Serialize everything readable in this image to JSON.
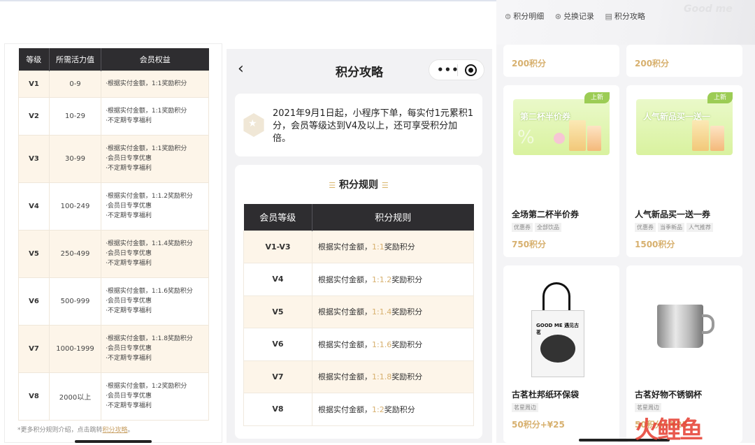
{
  "panel1": {
    "headers": [
      "等级",
      "所需活力值",
      "会员权益"
    ],
    "rows": [
      {
        "level": "V1",
        "value": "0-9",
        "benefits": [
          "·根据实付金额，1:1奖励积分"
        ]
      },
      {
        "level": "V2",
        "value": "10-29",
        "benefits": [
          "·根据实付金额，1:1奖励积分",
          "·不定期专享福利"
        ]
      },
      {
        "level": "V3",
        "value": "30-99",
        "benefits": [
          "·根据实付金额，1:1奖励积分",
          "·会员日专享优惠",
          "·不定期专享福利"
        ]
      },
      {
        "level": "V4",
        "value": "100-249",
        "benefits": [
          "·根据实付金额，1:1.2奖励积分",
          "·会员日专享优惠",
          "·不定期专享福利"
        ]
      },
      {
        "level": "V5",
        "value": "250-499",
        "benefits": [
          "·根据实付金额，1:1.4奖励积分",
          "·会员日专享优惠",
          "·不定期专享福利"
        ]
      },
      {
        "level": "V6",
        "value": "500-999",
        "benefits": [
          "·根据实付金额，1:1.6奖励积分",
          "·会员日专享优惠",
          "·不定期专享福利"
        ]
      },
      {
        "level": "V7",
        "value": "1000-1999",
        "benefits": [
          "·根据实付金额，1:1.8奖励积分",
          "·会员日专享优惠",
          "·不定期专享福利"
        ]
      },
      {
        "level": "V8",
        "value": "2000以上",
        "benefits": [
          "·根据实付金额，1:2奖励积分",
          "·会员日专享优惠",
          "·不定期专享福利"
        ]
      }
    ],
    "footnote": "*更多积分规则介绍，点击跳转",
    "footnote_link": "积分攻略",
    "footnote_end": "。"
  },
  "panel2": {
    "back_icon": "‹",
    "title": "积分攻略",
    "menu_icon": "•••",
    "notice": "2021年9月1日起，小程序下单，每实付1元累积1分，会员等级达到V4及以上，还可享受积分加倍。",
    "rules_title": "积分规则",
    "deco": "☰",
    "headers": [
      "会员等级",
      "积分规则"
    ],
    "rows": [
      {
        "level": "V1-V3",
        "pre": "根据实付金额，",
        "ratio": "1:1",
        "post": "奖励积分"
      },
      {
        "level": "V4",
        "pre": "根据实付金额，",
        "ratio": "1:1.2",
        "post": "奖励积分"
      },
      {
        "level": "V5",
        "pre": "根据实付金额，",
        "ratio": "1:1.4",
        "post": "奖励积分"
      },
      {
        "level": "V6",
        "pre": "根据实付金额，",
        "ratio": "1:1.6",
        "post": "奖励积分"
      },
      {
        "level": "V7",
        "pre": "根据实付金额，",
        "ratio": "1:1.8",
        "post": "奖励积分"
      },
      {
        "level": "V8",
        "pre": "根据实付金额，",
        "ratio": "1:2",
        "post": "奖励积分"
      }
    ]
  },
  "panel3": {
    "brand": "Good me",
    "links": [
      {
        "icon": "⊜",
        "label": "积分明细"
      },
      {
        "icon": "⊛",
        "label": "兑换记录"
      },
      {
        "icon": "▤",
        "label": "积分攻略"
      }
    ],
    "top_points": [
      "200积分",
      "200积分"
    ],
    "items": [
      {
        "coupon": "第二杯半价券",
        "badge": "上新",
        "name": "全场第二杯半价券",
        "tags": [
          "优惠券",
          "全部饮品"
        ],
        "points": "750积分"
      },
      {
        "coupon": "人气新品买一送一",
        "badge": "上新",
        "name": "人气新品买一送一券",
        "tags": [
          "优惠券",
          "当季新品",
          "人气推荐"
        ],
        "points": "1500积分"
      },
      {
        "name": "古茗杜邦纸环保袋",
        "tags": [
          "茗星周边"
        ],
        "points": "50积分+¥25",
        "bag_text": "GOOD ME 遇见古茗"
      },
      {
        "name": "古茗好物不锈钢杯",
        "tags": [
          "茗星周边"
        ],
        "points": "50积分+¥25"
      }
    ]
  },
  "watermark": "火鲤鱼",
  "colors": {
    "accent": "#d7b06e",
    "header_dark": "#2e2d30",
    "row_tint": "#fdf5e9"
  }
}
